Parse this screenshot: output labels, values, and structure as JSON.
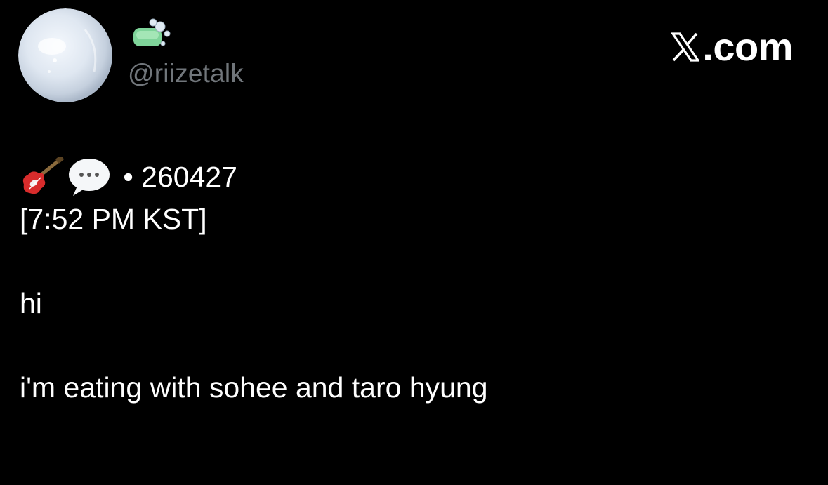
{
  "account": {
    "handle": "@riizetalk",
    "name_emoji": "soap-emoji",
    "avatar": "bubble-avatar"
  },
  "brand": {
    "label": ".com",
    "icon": "x-logo-icon"
  },
  "post": {
    "header_icons": [
      "guitar-emoji",
      "speech-bubble-emoji"
    ],
    "date_line": " • 260427",
    "time_line": "[7:52 PM KST]",
    "lines": [
      "hi",
      "i'm eating with sohee and taro hyung"
    ]
  },
  "colors": {
    "background": "#000000",
    "text": "#ffffff",
    "muted": "#71767b"
  }
}
